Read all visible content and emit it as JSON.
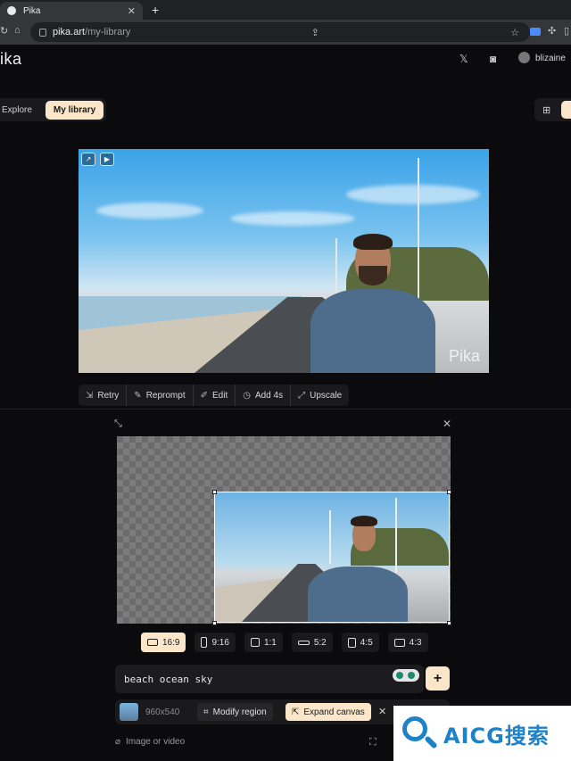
{
  "browser": {
    "tab_title": "Pika",
    "new_tab": "+",
    "tab_close": "✕",
    "url_host": "pika.art",
    "url_path": "/my-library"
  },
  "header": {
    "logo": "ika",
    "username": "blizaine"
  },
  "nav": {
    "explore": "Explore",
    "my_library": "My library"
  },
  "video": {
    "watermark": "Pika"
  },
  "actions": [
    {
      "label": "Retry",
      "icon": "retry-icon"
    },
    {
      "label": "Reprompt",
      "icon": "edit-pencil-icon"
    },
    {
      "label": "Edit",
      "icon": "brush-icon"
    },
    {
      "label": "Add 4s",
      "icon": "clock-plus-icon"
    },
    {
      "label": "Upscale",
      "icon": "expand-arrows-icon"
    }
  ],
  "ratios": [
    {
      "label": "16:9",
      "active": true
    },
    {
      "label": "9:16",
      "active": false
    },
    {
      "label": "1:1",
      "active": false
    },
    {
      "label": "5:2",
      "active": false
    },
    {
      "label": "4:5",
      "active": false
    },
    {
      "label": "4:3",
      "active": false
    }
  ],
  "prompt": {
    "text": "beach ocean sky"
  },
  "options": {
    "dimensions": "960x540",
    "modify_region": "Modify region",
    "expand_canvas": "Expand canvas"
  },
  "attach": {
    "label": "Image or video"
  },
  "watermark_site": {
    "text": "AICG搜索"
  },
  "colors": {
    "accent": "#fbe6c9",
    "background": "#0b0b0d",
    "panel": "#1a1a1c"
  }
}
